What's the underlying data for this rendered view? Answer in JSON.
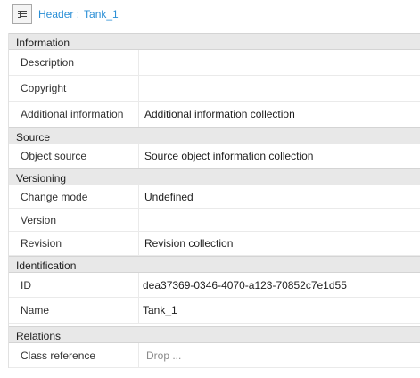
{
  "header": {
    "label": "Header :",
    "object_name": "Tank_1",
    "icon": "header-properties-icon"
  },
  "sections": {
    "information": {
      "title": "Information",
      "description_label": "Description",
      "description_value": "",
      "copyright_label": "Copyright",
      "copyright_value": "",
      "additional_label": "Additional information",
      "additional_value": "Additional information collection"
    },
    "source": {
      "title": "Source",
      "object_source_label": "Object source",
      "object_source_value": "Source object information collection"
    },
    "versioning": {
      "title": "Versioning",
      "change_mode_label": "Change mode",
      "change_mode_value": "Undefined",
      "version_label": "Version",
      "version_value": "",
      "revision_label": "Revision",
      "revision_value": "Revision collection"
    },
    "identification": {
      "title": "Identification",
      "id_label": "ID",
      "id_value": "dea37369-0346-4070-a123-70852c7e1d55",
      "name_label": "Name",
      "name_value": "Tank_1"
    },
    "relations": {
      "title": "Relations",
      "class_ref_label": "Class reference",
      "class_ref_placeholder": "Drop ..."
    }
  }
}
